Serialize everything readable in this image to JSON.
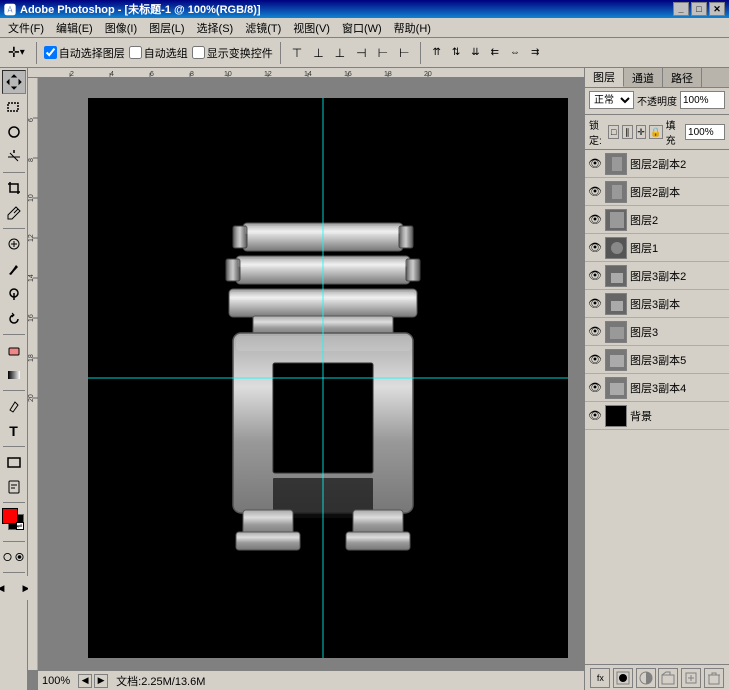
{
  "titleBar": {
    "title": "Adobe Photoshop - [未标题-1 @ 100%(RGB/8)]",
    "appName": "Adobe Photoshop",
    "docTitle": "[未标题-1 @ 100%(RGB/8)]",
    "controls": [
      "_",
      "□",
      "✕"
    ]
  },
  "menuBar": {
    "items": [
      "文件(F)",
      "编辑(E)",
      "图像(I)",
      "图层(L)",
      "选择(S)",
      "滤镜(T)",
      "视图(V)",
      "窗口(W)",
      "帮助(H)"
    ]
  },
  "toolbar": {
    "autoSelectLayer": "自动选择图层",
    "autoSelectGroup": "自动选组",
    "showTransformControls": "显示变换控件",
    "arrowIcon": "↕"
  },
  "statusBar": {
    "zoom": "100%",
    "docInfo": "文档:2.25M/13.6M"
  },
  "rightPanel": {
    "tabs": [
      "图层",
      "通道",
      "路径"
    ],
    "blendMode": "正常",
    "opacityLabel": "不透明度",
    "lockLabel": "锁定:",
    "fillLabel": "填充",
    "lockIcons": [
      "□",
      "∥",
      "中",
      "🔒"
    ],
    "layers": [
      {
        "name": "图层2副本2",
        "visible": true,
        "thumb": "gray",
        "active": false
      },
      {
        "name": "图层2副本",
        "visible": true,
        "thumb": "gray",
        "active": false
      },
      {
        "name": "图层2",
        "visible": true,
        "thumb": "gray",
        "active": false
      },
      {
        "name": "图层1",
        "visible": true,
        "thumb": "gray",
        "active": false
      },
      {
        "name": "图层3副本2",
        "visible": true,
        "thumb": "gray",
        "active": false
      },
      {
        "name": "图层3副本",
        "visible": true,
        "thumb": "gray",
        "active": false
      },
      {
        "name": "图层3",
        "visible": true,
        "thumb": "gray",
        "active": false
      },
      {
        "name": "图层3副本5",
        "visible": true,
        "thumb": "gray",
        "active": false
      },
      {
        "name": "图层3副本4",
        "visible": true,
        "thumb": "gray",
        "active": false
      },
      {
        "name": "背景",
        "visible": true,
        "thumb": "black",
        "active": false
      }
    ],
    "footerBtns": [
      "fx",
      "□",
      "🗑",
      "+",
      "≡"
    ]
  },
  "toolbox": {
    "tools": [
      "↕",
      "✂",
      "⬚",
      "⊹",
      "✒",
      "🖊",
      "S",
      "T",
      "◻",
      "⊕",
      "🖐",
      "🔍",
      "◼",
      "◻"
    ]
  },
  "canvas": {
    "bgColor": "#000000",
    "guideH": 230,
    "guideV": 230
  }
}
